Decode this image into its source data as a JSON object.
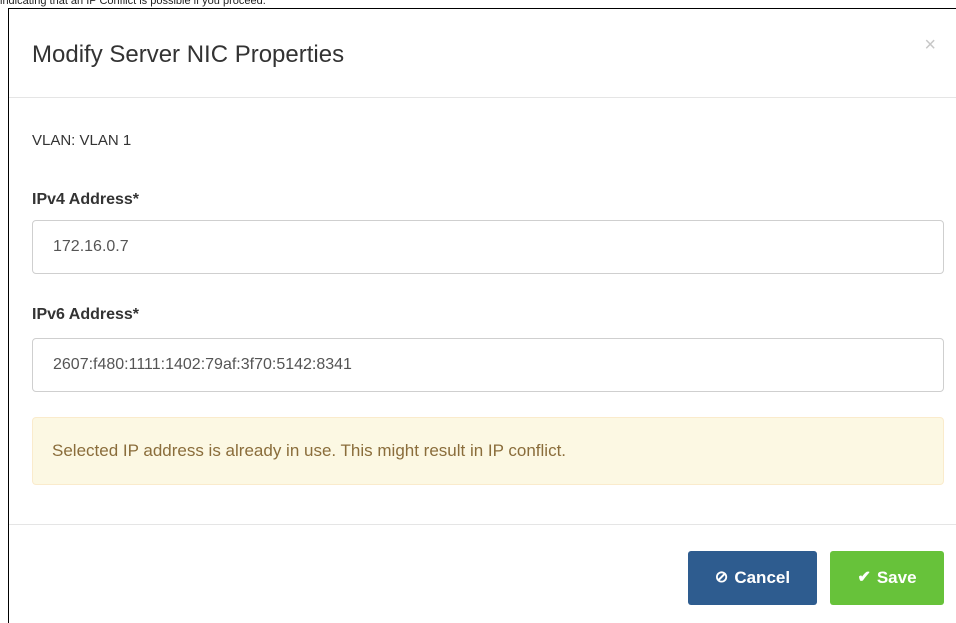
{
  "caption": "indicating that an IP Conflict is possible if you proceed.",
  "dialog": {
    "title": "Modify Server NIC Properties",
    "close_icon": "close-icon",
    "close_glyph": "×",
    "vlan_text": "VLAN: VLAN 1",
    "ipv4": {
      "label": "IPv4 Address*",
      "value": "172.16.0.7"
    },
    "ipv6": {
      "label": "IPv6 Address*",
      "value": "2607:f480:1111:1402:79af:3f70:5142:8341"
    },
    "alert_text": "Selected IP address is already in use. This might result in IP conflict.",
    "buttons": {
      "cancel": {
        "label": "Cancel",
        "icon": "ban-icon",
        "glyph": "⊘",
        "color": "#2e5c8f"
      },
      "save": {
        "label": "Save",
        "icon": "check-icon",
        "glyph": "✔",
        "color": "#67c23a"
      }
    }
  },
  "colors": {
    "warning_bg": "#fcf8e3",
    "warning_text": "#8a6d3b"
  }
}
